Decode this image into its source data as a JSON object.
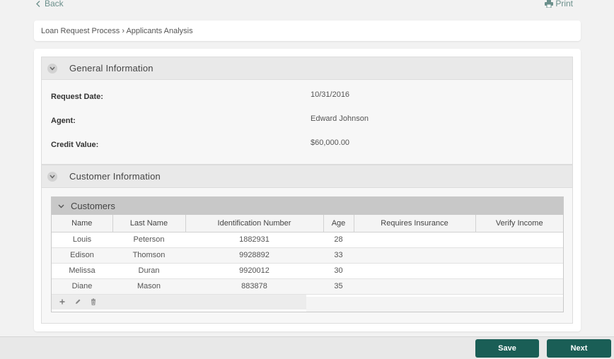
{
  "nav": {
    "back_label": "Back",
    "print_label": "Print"
  },
  "breadcrumb": "Loan Request Process › Applicants Analysis",
  "general": {
    "title": "General Information",
    "fields": [
      {
        "label": "Request Date:",
        "value": "10/31/2016"
      },
      {
        "label": "Agent:",
        "value": "Edward Johnson"
      },
      {
        "label": "Credit Value:",
        "value": "$60,000.00"
      }
    ]
  },
  "customer_info": {
    "title": "Customer Information",
    "grid": {
      "title": "Customers",
      "columns": [
        "Name",
        "Last Name",
        "Identification Number",
        "Age",
        "Requires Insurance",
        "Verify Income"
      ],
      "rows": [
        [
          "Louis",
          "Peterson",
          "1882931",
          "28",
          "",
          ""
        ],
        [
          "Edison",
          "Thomson",
          "9928892",
          "33",
          "",
          ""
        ],
        [
          "Melissa",
          "Duran",
          "9920012",
          "30",
          "",
          ""
        ],
        [
          "Diane",
          "Mason",
          "883878",
          "35",
          "",
          ""
        ]
      ],
      "toolbar_icons": [
        "add-icon",
        "edit-icon",
        "delete-icon"
      ]
    }
  },
  "actions": {
    "save_label": "Save",
    "next_label": "Next"
  },
  "colors": {
    "accent": "#1a5e56",
    "link": "#6b8f8b"
  }
}
